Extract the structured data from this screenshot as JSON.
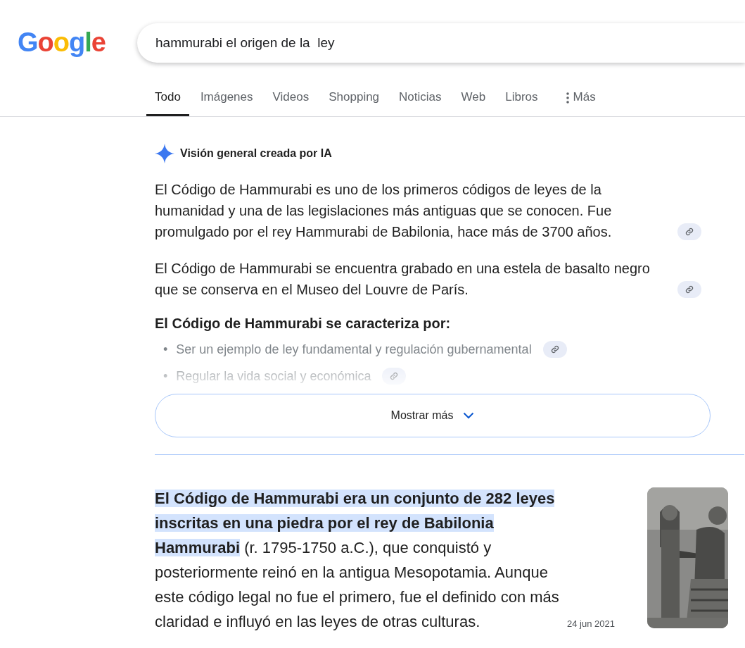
{
  "logo": "Google",
  "search": {
    "value": "hammurabi el origen de la  ley"
  },
  "tabs": [
    {
      "label": "Todo",
      "selected": true,
      "kind": "text"
    },
    {
      "label": "Imágenes",
      "selected": false,
      "kind": "text"
    },
    {
      "label": "Videos",
      "selected": false,
      "kind": "text"
    },
    {
      "label": "Shopping",
      "selected": false,
      "kind": "text"
    },
    {
      "label": "Noticias",
      "selected": false,
      "kind": "text"
    },
    {
      "label": "Web",
      "selected": false,
      "kind": "text"
    },
    {
      "label": "Libros",
      "selected": false,
      "kind": "text"
    },
    {
      "label": "Más",
      "selected": false,
      "kind": "more"
    }
  ],
  "ai_overview": {
    "title": "Visión general creada por IA",
    "expanded": false,
    "paragraphs": [
      "El Código de Hammurabi es uno de los primeros códigos de leyes de la humanidad y una de las legislaciones más antiguas que se conocen. Fue promulgado por el rey Hammurabi de Babilonia, hace más de 3700 años.",
      "El Código de Hammurabi se encuentra grabado en una estela de basalto negro que se conserva en el Museo del Louvre de París."
    ],
    "heading": "El Código de Hammurabi se caracteriza por:",
    "bullets": [
      {
        "marker": "•",
        "text": "Ser un ejemplo de ley fundamental y regulación gubernamental"
      },
      {
        "marker": "•",
        "text": "Regular la vida social y económica"
      }
    ],
    "show_more": "Mostrar más"
  },
  "snippet": {
    "text": "**El Código de Hammurabi era un conjunto de 282 leyes inscritas en una piedra por el rey de Babilonia Hammurabi** (r. 1795-1750 a.C.), que conquistó y posteriormente reinó en la antigua Mesopotamia. Aunque este código legal no fue el primero, fue el definido con más claridad e influyó en las leyes de otras culturas.",
    "date": "24 jun 2021"
  }
}
